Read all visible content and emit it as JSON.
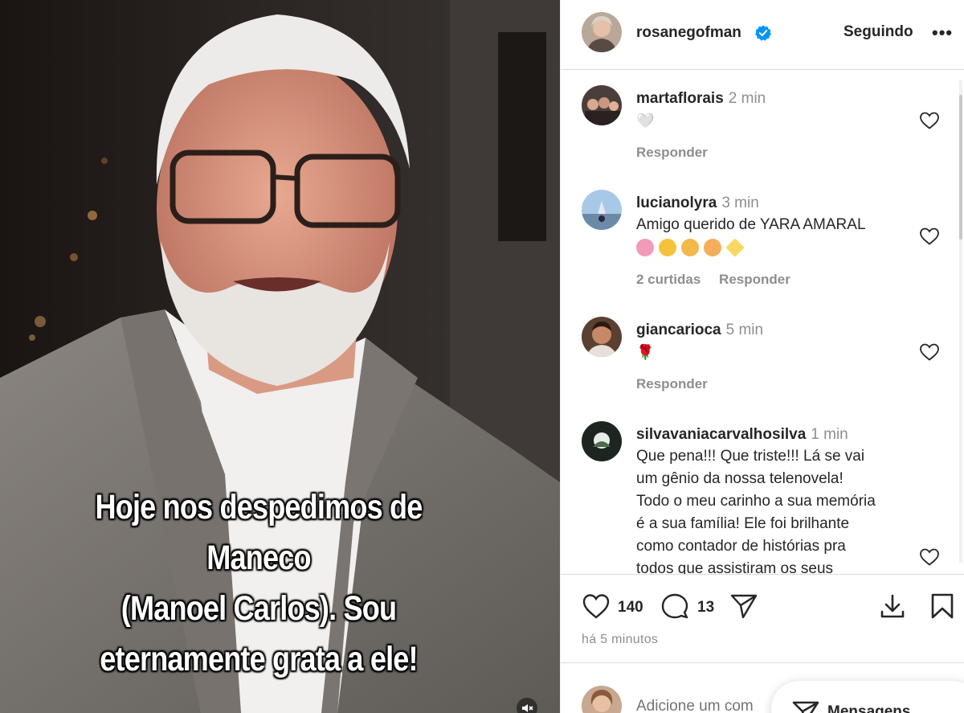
{
  "post": {
    "caption": "Hoje nos  despedimos de Maneco\n(Manoel Carlos). Sou\neternamente grata a ele!",
    "media_type": "video",
    "mute_icon": "speaker-muted-icon"
  },
  "header": {
    "username": "rosanegofman",
    "verified": true,
    "follow_label": "Seguindo",
    "more_label": "•••"
  },
  "comments": [
    {
      "username": "martaflorais",
      "time": "2 min",
      "text": "🤍",
      "likes_label": "",
      "reply_label": "Responder"
    },
    {
      "username": "lucianolyra",
      "time": "3 min",
      "text": "Amigo querido de YARA AMARAL",
      "emojis": [
        "💞",
        "😔",
        "🥺",
        "😱",
        "✨"
      ],
      "likes_label": "2 curtidas",
      "reply_label": "Responder"
    },
    {
      "username": "giancarioca",
      "time": "5 min",
      "text": "🌹",
      "likes_label": "",
      "reply_label": "Responder"
    },
    {
      "username": "silvavaniacarvalhosilva",
      "time": "1 min",
      "text": "Que pena!!! Que triste!!! Lá se vai\num gênio da nossa telenovela!\nTodo o meu carinho a sua memória\né a sua família! Ele foi brilhante\ncomo contador de histórias pra\ntodos que assistiram os seus",
      "likes_label": "",
      "reply_label": ""
    }
  ],
  "actions": {
    "like_count": "140",
    "comment_count": "13",
    "posted_ago": "há 5 minutos"
  },
  "add_comment": {
    "placeholder": "Adicione um com",
    "messages_label": "Mensagens"
  },
  "colors": {
    "verified_blue": "#0095f6",
    "muted_text": "#8e8e8e",
    "text": "#262626",
    "border": "#dbdbdb"
  }
}
